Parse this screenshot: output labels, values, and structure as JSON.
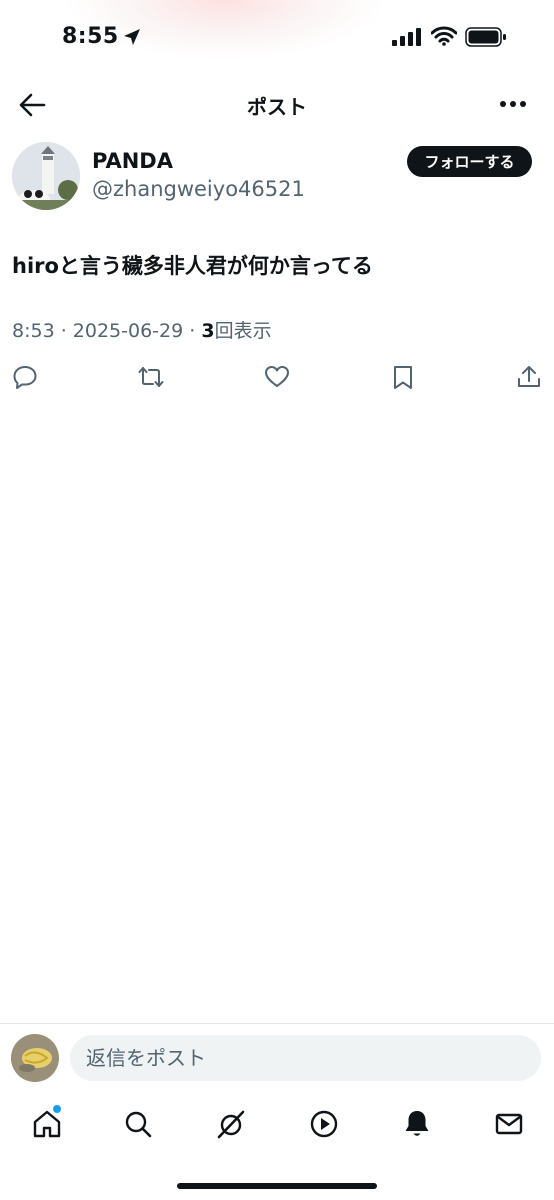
{
  "status_bar": {
    "time": "8:55"
  },
  "header": {
    "title": "ポスト"
  },
  "post": {
    "author_name": "PANDA",
    "author_handle": "@zhangweiyo46521",
    "follow_label": "フォローする",
    "text": "hiroと言う穢多非人君が何か言ってる",
    "time": "8:53",
    "date": "2025-06-29",
    "separator": " · ",
    "views_count": "3",
    "views_label": "回表示"
  },
  "reply": {
    "placeholder": "返信をポスト"
  },
  "colors": {
    "text_primary": "#0f1419",
    "text_secondary": "#536471",
    "accent": "#1d9bf0",
    "input_bg": "#eff3f4"
  },
  "icons": {
    "actions": [
      "reply-icon",
      "repost-icon",
      "like-icon",
      "bookmark-icon",
      "share-icon"
    ],
    "tabs": [
      "home-icon",
      "search-icon",
      "grok-icon",
      "video-icon",
      "notifications-icon",
      "messages-icon"
    ]
  }
}
